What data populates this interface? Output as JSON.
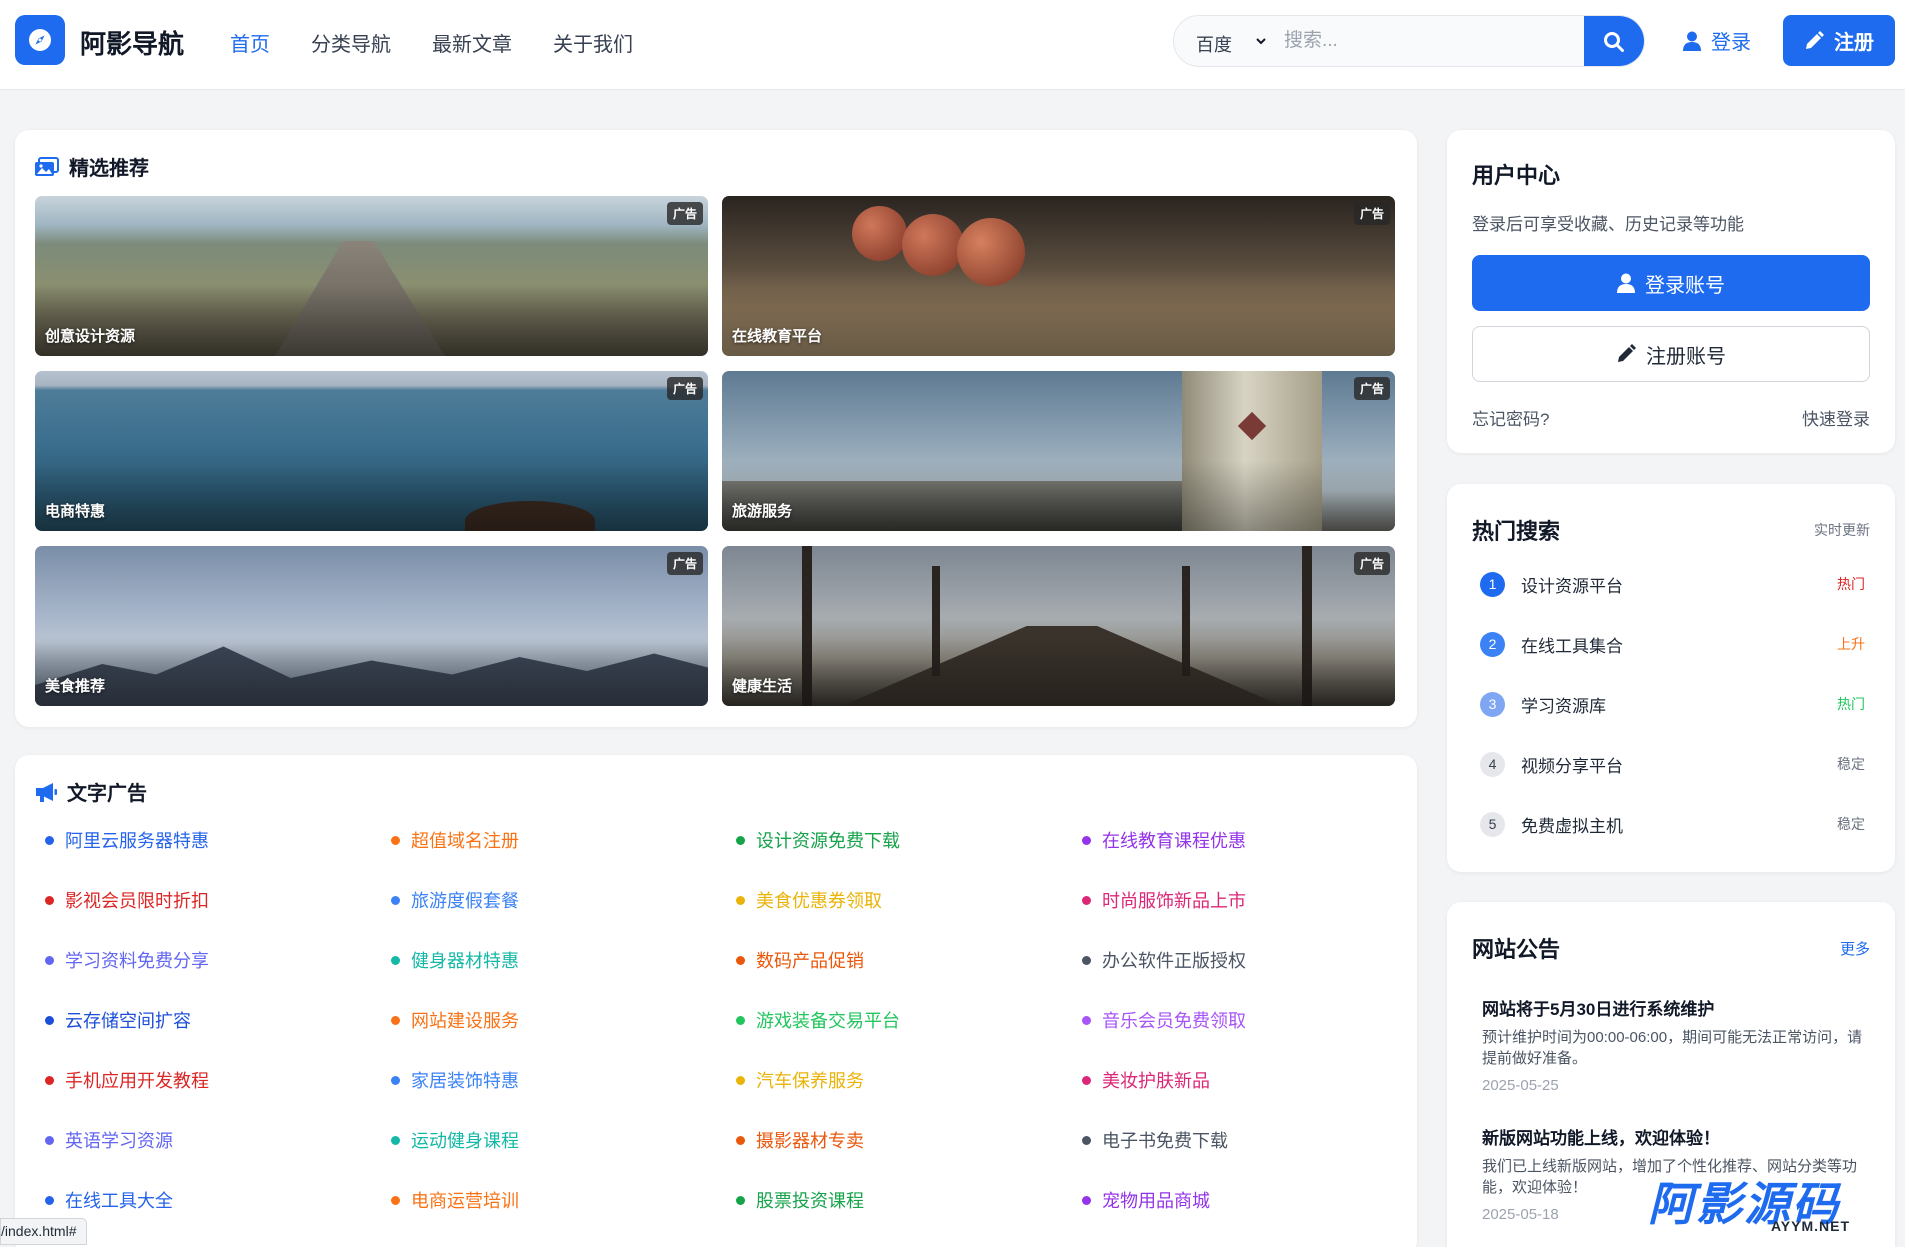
{
  "header": {
    "logo_text": "阿影导航",
    "nav": [
      "首页",
      "分类导航",
      "最新文章",
      "关于我们"
    ],
    "search": {
      "engine": "百度",
      "placeholder": "搜索..."
    },
    "login_label": "登录",
    "register_label": "注册"
  },
  "featured": {
    "title": "精选推荐",
    "ad_label": "广告",
    "items": [
      {
        "caption": "创意设计资源"
      },
      {
        "caption": "在线教育平台"
      },
      {
        "caption": "电商特惠"
      },
      {
        "caption": "旅游服务"
      },
      {
        "caption": "美食推荐"
      },
      {
        "caption": "健康生活"
      }
    ]
  },
  "text_ads": {
    "title": "文字广告",
    "items": [
      {
        "text": "阿里云服务器特惠",
        "color": "#2563eb"
      },
      {
        "text": "超值域名注册",
        "color": "#f97316"
      },
      {
        "text": "设计资源免费下载",
        "color": "#16a34a"
      },
      {
        "text": "在线教育课程优惠",
        "color": "#9333ea"
      },
      {
        "text": "影视会员限时折扣",
        "color": "#dc2626"
      },
      {
        "text": "旅游度假套餐",
        "color": "#3b82f6"
      },
      {
        "text": "美食优惠券领取",
        "color": "#eab308"
      },
      {
        "text": "时尚服饰新品上市",
        "color": "#db2777"
      },
      {
        "text": "学习资料免费分享",
        "color": "#6366f1"
      },
      {
        "text": "健身器材特惠",
        "color": "#14b8a6"
      },
      {
        "text": "数码产品促销",
        "color": "#ea580c"
      },
      {
        "text": "办公软件正版授权",
        "color": "#4b5563"
      },
      {
        "text": "云存储空间扩容",
        "color": "#1d4ed8"
      },
      {
        "text": "网站建设服务",
        "color": "#f97316"
      },
      {
        "text": "游戏装备交易平台",
        "color": "#22c55e"
      },
      {
        "text": "音乐会员免费领取",
        "color": "#a855f7"
      },
      {
        "text": "手机应用开发教程",
        "color": "#dc2626"
      },
      {
        "text": "家居装饰特惠",
        "color": "#3b82f6"
      },
      {
        "text": "汽车保养服务",
        "color": "#eab308"
      },
      {
        "text": "美妆护肤新品",
        "color": "#db2777"
      },
      {
        "text": "英语学习资源",
        "color": "#6366f1"
      },
      {
        "text": "运动健身课程",
        "color": "#14b8a6"
      },
      {
        "text": "摄影器材专卖",
        "color": "#ea580c"
      },
      {
        "text": "电子书免费下载",
        "color": "#4b5563"
      },
      {
        "text": "在线工具大全",
        "color": "#2563eb"
      },
      {
        "text": "电商运营培训",
        "color": "#f97316"
      },
      {
        "text": "股票投资课程",
        "color": "#16a34a"
      },
      {
        "text": "宠物用品商城",
        "color": "#9333ea"
      }
    ]
  },
  "user_center": {
    "title": "用户中心",
    "desc": "登录后可享受收藏、历史记录等功能",
    "login_button": "登录账号",
    "register_button": "注册账号",
    "forgot": "忘记密码?",
    "quick_login": "快速登录"
  },
  "hot_search": {
    "title": "热门搜索",
    "subtitle": "实时更新",
    "items": [
      {
        "rank": "1",
        "name": "设计资源平台",
        "tag": "热门",
        "tag_color": "#dc2626",
        "badge_color": "#1e6bf0"
      },
      {
        "rank": "2",
        "name": "在线工具集合",
        "tag": "上升",
        "tag_color": "#f97316",
        "badge_color": "#3b82f6"
      },
      {
        "rank": "3",
        "name": "学习资源库",
        "tag": "热门",
        "tag_color": "#22c55e",
        "badge_color": "#7ea6f3"
      },
      {
        "rank": "4",
        "name": "视频分享平台",
        "tag": "稳定",
        "tag_color": "#6b7280",
        "badge_color": "#e5e7eb"
      },
      {
        "rank": "5",
        "name": "免费虚拟主机",
        "tag": "稳定",
        "tag_color": "#6b7280",
        "badge_color": "#e5e7eb"
      }
    ]
  },
  "announcements": {
    "title": "网站公告",
    "more": "更多",
    "items": [
      {
        "title": "网站将于5月30日进行系统维护",
        "body": "预计维护时间为00:00-06:00，期间可能无法正常访问，请提前做好准备。",
        "date": "2025-05-25"
      },
      {
        "title": "新版网站功能上线，欢迎体验！",
        "body": "我们已上线新版网站，增加了个性化推荐、网站分类等功能，欢迎体验！",
        "date": "2025-05-18"
      }
    ]
  },
  "status_bar": "/index.html#",
  "watermark": {
    "main": "阿影源码",
    "sub": "AYYM.NET"
  }
}
